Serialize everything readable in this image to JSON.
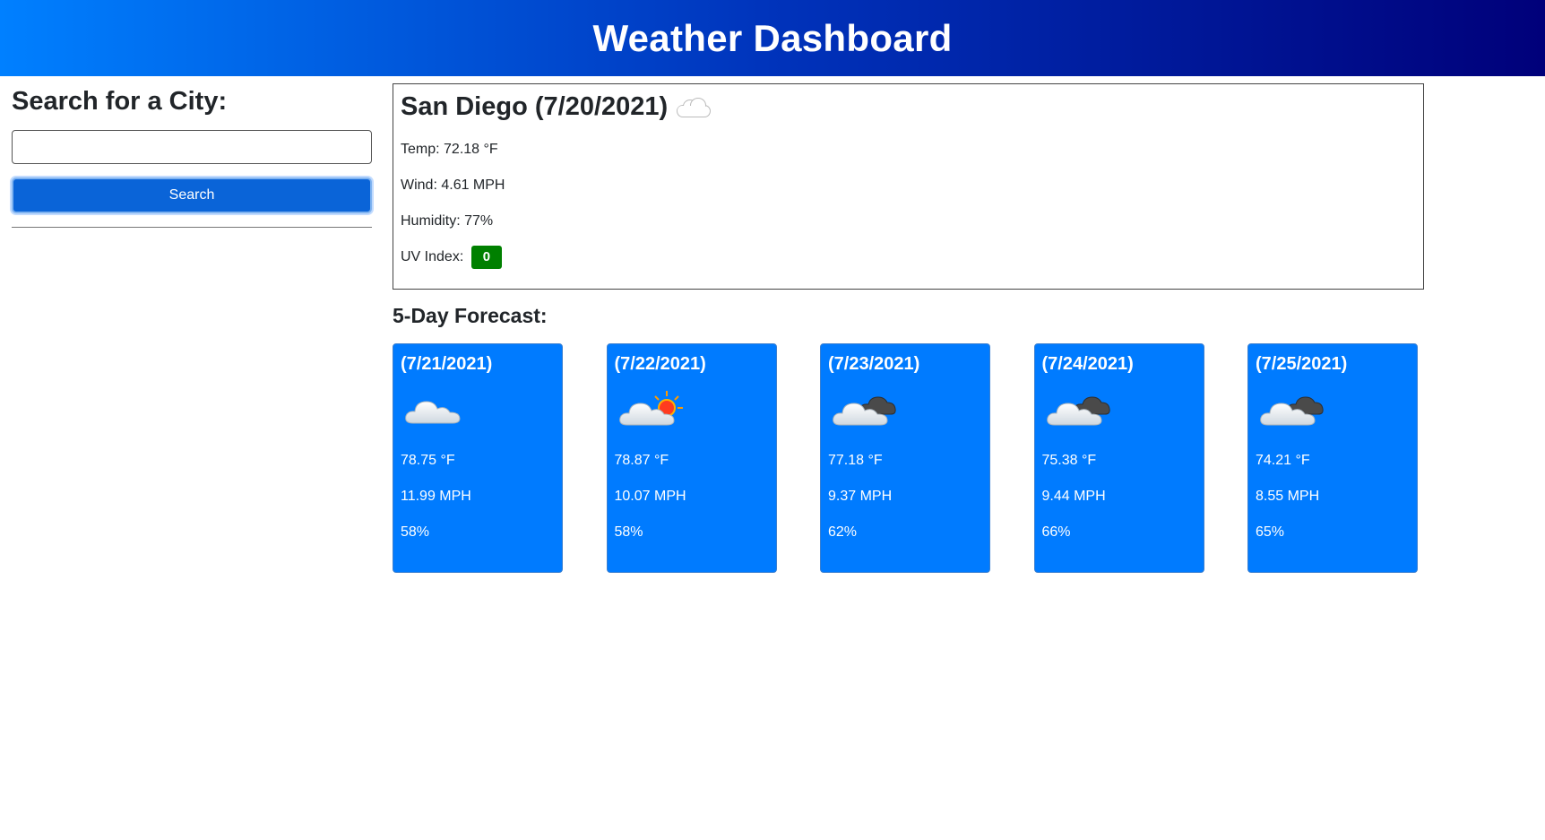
{
  "header": {
    "title": "Weather Dashboard"
  },
  "sidebar": {
    "heading": "Search for a City:",
    "search_value": "",
    "search_placeholder": "",
    "search_button_label": "Search"
  },
  "current": {
    "title": "San Diego (7/20/2021)",
    "icon": "cloud-icon",
    "temp": "Temp: 72.18 °F",
    "wind": "Wind: 4.61 MPH",
    "humidity": "Humidity: 77%",
    "uv_label": "UV Index:",
    "uv_value": "0",
    "uv_color": "#008000"
  },
  "forecast": {
    "heading": "5-Day Forecast:",
    "card_color": "#007bff",
    "days": [
      {
        "date": "(7/21/2021)",
        "icon": "cloud-icon",
        "temp": "78.75 °F",
        "wind": "11.99 MPH",
        "humidity": "58%"
      },
      {
        "date": "(7/22/2021)",
        "icon": "cloud-sun-icon",
        "temp": "78.87 °F",
        "wind": "10.07 MPH",
        "humidity": "58%"
      },
      {
        "date": "(7/23/2021)",
        "icon": "dark-clouds-icon",
        "temp": "77.18 °F",
        "wind": "9.37 MPH",
        "humidity": "62%"
      },
      {
        "date": "(7/24/2021)",
        "icon": "dark-clouds-icon",
        "temp": "75.38 °F",
        "wind": "9.44 MPH",
        "humidity": "66%"
      },
      {
        "date": "(7/25/2021)",
        "icon": "dark-clouds-icon",
        "temp": "74.21 °F",
        "wind": "8.55 MPH",
        "humidity": "65%"
      }
    ]
  }
}
